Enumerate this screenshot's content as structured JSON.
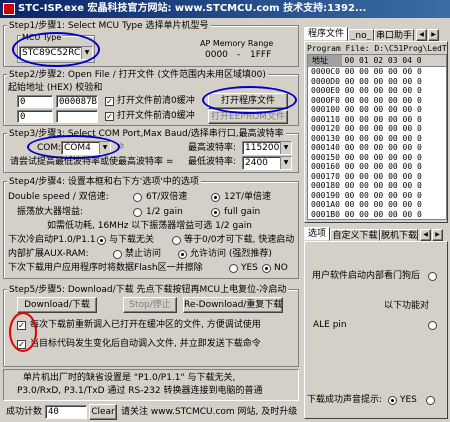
{
  "window": {
    "title": "STC-ISP.exe      宏晶科技官方网站: www.STCMCU.com    技术支持:1392..."
  },
  "step1": {
    "title": "Step1/步骤1: Select MCU Type  选择单片机型号",
    "mcu_type_label": "MCU Type",
    "mcu_type_value": "STC89C52RC",
    "ap_memory_label": "AP Memory Range",
    "range_start": "0000",
    "range_end": "1FFF",
    "range_sep": "-"
  },
  "step2": {
    "title": "Step2/步骤2: Open File / 打开文件 (文件范围内未用区域填00)",
    "start_addr_label": "起始地址 (HEX) 校验和",
    "addr1": "0",
    "checksum1": "000087BH",
    "addr2": "0",
    "clear_buffer1_label": "打开文件前清0缓冲",
    "clear_buffer2_label": "打开文件前清0缓冲",
    "open_file_button": "打开程序文件",
    "open_eeprom_button": "打开EEPROM文件"
  },
  "step3": {
    "title": "Step3/步骤3: Select COM Port,Max Baud/选择串行口,最高波特率",
    "com_label": "COM:",
    "com_value": "COM4",
    "max_baud_label": "最高波特率:",
    "max_baud_value": "115200",
    "min_baud_label": "最低波特率:",
    "min_baud_value": "2400",
    "note": "请尝试提高最低波特率或使最高波特率 ="
  },
  "step4": {
    "title": "Step4/步骤4: 设置本框和右下方'选项'中的选项",
    "double_speed_label": "Double speed / 双倍速:",
    "opt_6t": "6T/双倍速",
    "opt_12t": "12T/单倍速",
    "amp_label": "振荡放大器增益:",
    "opt_half": "1/2 gain",
    "opt_full": "full gain",
    "amp_note": "如需低功耗, 16MHz 以下振荡器增益可选 1/2 gain",
    "p1_label": "下次冷启动P1.0/P1.1",
    "p1_opt1": "与下载无关",
    "p1_opt2": "等于0/0才可下载, 快速启动",
    "aux_label": "内部扩展AUX-RAM:",
    "aux_opt1": "禁止访问",
    "aux_opt2": "允许访问 (强烈推荐)",
    "flash_label": "下次下载用户应用程序时将数据Flash区一并擦除",
    "yes": "YES",
    "no": "NO"
  },
  "step5": {
    "title": "Step5/步骤5: Download/下载    先点下载按钮再MCU上电复位-冷启动",
    "download_button": "Download/下载",
    "stop_button": "Stop/停止",
    "redownload_button": "Re-Download/重复下载",
    "reload_label": "每次下载前重新调入已打开在缓冲区的文件, 方便调试使用",
    "auto_label": "当目标代码发生变化后自动调入文件, 并立即发送下载命令"
  },
  "note_box": {
    "line1": "单片机出厂时的缺省设置是 \"P1.0/P1.1\" 与下载无关,",
    "line2": "P3.0/RxD, P3.1/TxD 通过 RS-232 转换器连接到电脑的普通"
  },
  "bottom": {
    "success_label": "成功计数",
    "success_count": "40",
    "clear_button": "Clear",
    "visit_text": "请关注 www.STCMCU.com 网站, 及时升级"
  },
  "right_top": {
    "tabs": [
      "程序文件",
      "_no_",
      "串口助手"
    ],
    "file_label": "Program File: D:\\C51Prog\\LedT",
    "addr_header": "地址",
    "col_header": "00 01 02 03 04 0",
    "rows": [
      "0000C0  00 00 00 00 00 0",
      "0000D0  00 00 00 00 00 0",
      "0000E0  00 00 00 00 00 0",
      "0000F0  00 00 00 00 00 0",
      "000100  00 00 00 00 00 0",
      "000110  00 00 00 00 00 0",
      "000120  00 00 00 00 00 0",
      "000130  00 00 00 00 00 0",
      "000140  00 00 00 00 00 0",
      "000150  00 00 00 00 00 0",
      "000160  00 00 00 00 00 0",
      "000170  00 00 00 00 00 0",
      "000180  00 00 00 00 00 0",
      "000190  00 00 00 00 00 0",
      "0001A0  00 00 00 00 00 0",
      "0001B0  00 00 00 00 00 0"
    ]
  },
  "right_bottom": {
    "tabs": [
      "选项",
      "自定义下载",
      "脱机下载"
    ],
    "opt1": "用户软件启动内部看门狗后",
    "opt2": "以下功能对",
    "opt3": "ALE pin",
    "sound_label": "下载成功声音提示:",
    "sound_yes": "YES"
  }
}
